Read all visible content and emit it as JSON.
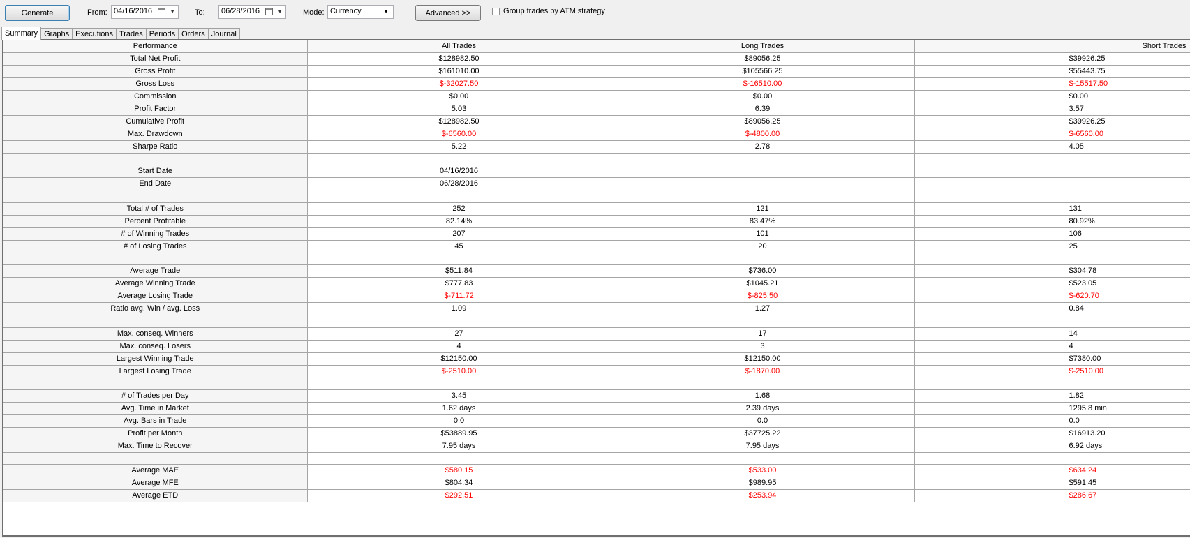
{
  "toolbar": {
    "generate_label": "Generate",
    "from_label": "From:",
    "from_value": "04/16/2016",
    "to_label": "To:",
    "to_value": "06/28/2016",
    "mode_label": "Mode:",
    "mode_value": "Currency",
    "advanced_label": "Advanced >>",
    "group_label": "Group trades by ATM strategy"
  },
  "tabs": [
    "Summary",
    "Graphs",
    "Executions",
    "Trades",
    "Periods",
    "Orders",
    "Journal"
  ],
  "active_tab": "Summary",
  "colors": {
    "negative": "#ff0000"
  },
  "table": {
    "headers": [
      "Performance",
      "All Trades",
      "Long Trades",
      "Short Trades"
    ],
    "rows": [
      {
        "label": "Total Net Profit",
        "values": [
          "$128982.50",
          "$89056.25",
          "$39926.25"
        ],
        "neg": false
      },
      {
        "label": "Gross Profit",
        "values": [
          "$161010.00",
          "$105566.25",
          "$55443.75"
        ],
        "neg": false
      },
      {
        "label": "Gross Loss",
        "values": [
          "$-32027.50",
          "$-16510.00",
          "$-15517.50"
        ],
        "neg": true
      },
      {
        "label": "Commission",
        "values": [
          "$0.00",
          "$0.00",
          "$0.00"
        ],
        "neg": false
      },
      {
        "label": "Profit Factor",
        "values": [
          "5.03",
          "6.39",
          "3.57"
        ],
        "neg": false
      },
      {
        "label": "Cumulative Profit",
        "values": [
          "$128982.50",
          "$89056.25",
          "$39926.25"
        ],
        "neg": false
      },
      {
        "label": "Max. Drawdown",
        "values": [
          "$-6560.00",
          "$-4800.00",
          "$-6560.00"
        ],
        "neg": true
      },
      {
        "label": "Sharpe Ratio",
        "values": [
          "5.22",
          "2.78",
          "4.05"
        ],
        "neg": false
      },
      {
        "label": "",
        "values": [
          "",
          "",
          ""
        ],
        "neg": false
      },
      {
        "label": "Start Date",
        "values": [
          "04/16/2016",
          "",
          ""
        ],
        "neg": false
      },
      {
        "label": "End Date",
        "values": [
          "06/28/2016",
          "",
          ""
        ],
        "neg": false
      },
      {
        "label": "",
        "values": [
          "",
          "",
          ""
        ],
        "neg": false
      },
      {
        "label": "Total # of Trades",
        "values": [
          "252",
          "121",
          "131"
        ],
        "neg": false
      },
      {
        "label": "Percent Profitable",
        "values": [
          "82.14%",
          "83.47%",
          "80.92%"
        ],
        "neg": false
      },
      {
        "label": "# of Winning Trades",
        "values": [
          "207",
          "101",
          "106"
        ],
        "neg": false
      },
      {
        "label": "# of Losing Trades",
        "values": [
          "45",
          "20",
          "25"
        ],
        "neg": false
      },
      {
        "label": "",
        "values": [
          "",
          "",
          ""
        ],
        "neg": false
      },
      {
        "label": "Average Trade",
        "values": [
          "$511.84",
          "$736.00",
          "$304.78"
        ],
        "neg": false
      },
      {
        "label": "Average Winning Trade",
        "values": [
          "$777.83",
          "$1045.21",
          "$523.05"
        ],
        "neg": false
      },
      {
        "label": "Average Losing Trade",
        "values": [
          "$-711.72",
          "$-825.50",
          "$-620.70"
        ],
        "neg": true
      },
      {
        "label": "Ratio avg. Win / avg. Loss",
        "values": [
          "1.09",
          "1.27",
          "0.84"
        ],
        "neg": false
      },
      {
        "label": "",
        "values": [
          "",
          "",
          ""
        ],
        "neg": false
      },
      {
        "label": "Max. conseq. Winners",
        "values": [
          "27",
          "17",
          "14"
        ],
        "neg": false
      },
      {
        "label": "Max. conseq. Losers",
        "values": [
          "4",
          "3",
          "4"
        ],
        "neg": false
      },
      {
        "label": "Largest Winning Trade",
        "values": [
          "$12150.00",
          "$12150.00",
          "$7380.00"
        ],
        "neg": false
      },
      {
        "label": "Largest Losing Trade",
        "values": [
          "$-2510.00",
          "$-1870.00",
          "$-2510.00"
        ],
        "neg": true
      },
      {
        "label": "",
        "values": [
          "",
          "",
          ""
        ],
        "neg": false
      },
      {
        "label": "# of Trades per Day",
        "values": [
          "3.45",
          "1.68",
          "1.82"
        ],
        "neg": false
      },
      {
        "label": "Avg. Time in Market",
        "values": [
          "1.62 days",
          "2.39 days",
          "1295.8 min"
        ],
        "neg": false
      },
      {
        "label": "Avg. Bars in Trade",
        "values": [
          "0.0",
          "0.0",
          "0.0"
        ],
        "neg": false
      },
      {
        "label": "Profit per Month",
        "values": [
          "$53889.95",
          "$37725.22",
          "$16913.20"
        ],
        "neg": false
      },
      {
        "label": "Max. Time to Recover",
        "values": [
          "7.95 days",
          "7.95 days",
          "6.92 days"
        ],
        "neg": false
      },
      {
        "label": "",
        "values": [
          "",
          "",
          ""
        ],
        "neg": false
      },
      {
        "label": "Average MAE",
        "values": [
          "$580.15",
          "$533.00",
          "$634.24"
        ],
        "neg": true
      },
      {
        "label": "Average MFE",
        "values": [
          "$804.34",
          "$989.95",
          "$591.45"
        ],
        "neg": false
      },
      {
        "label": "Average ETD",
        "values": [
          "$292.51",
          "$253.94",
          "$286.67"
        ],
        "neg": true
      }
    ]
  }
}
